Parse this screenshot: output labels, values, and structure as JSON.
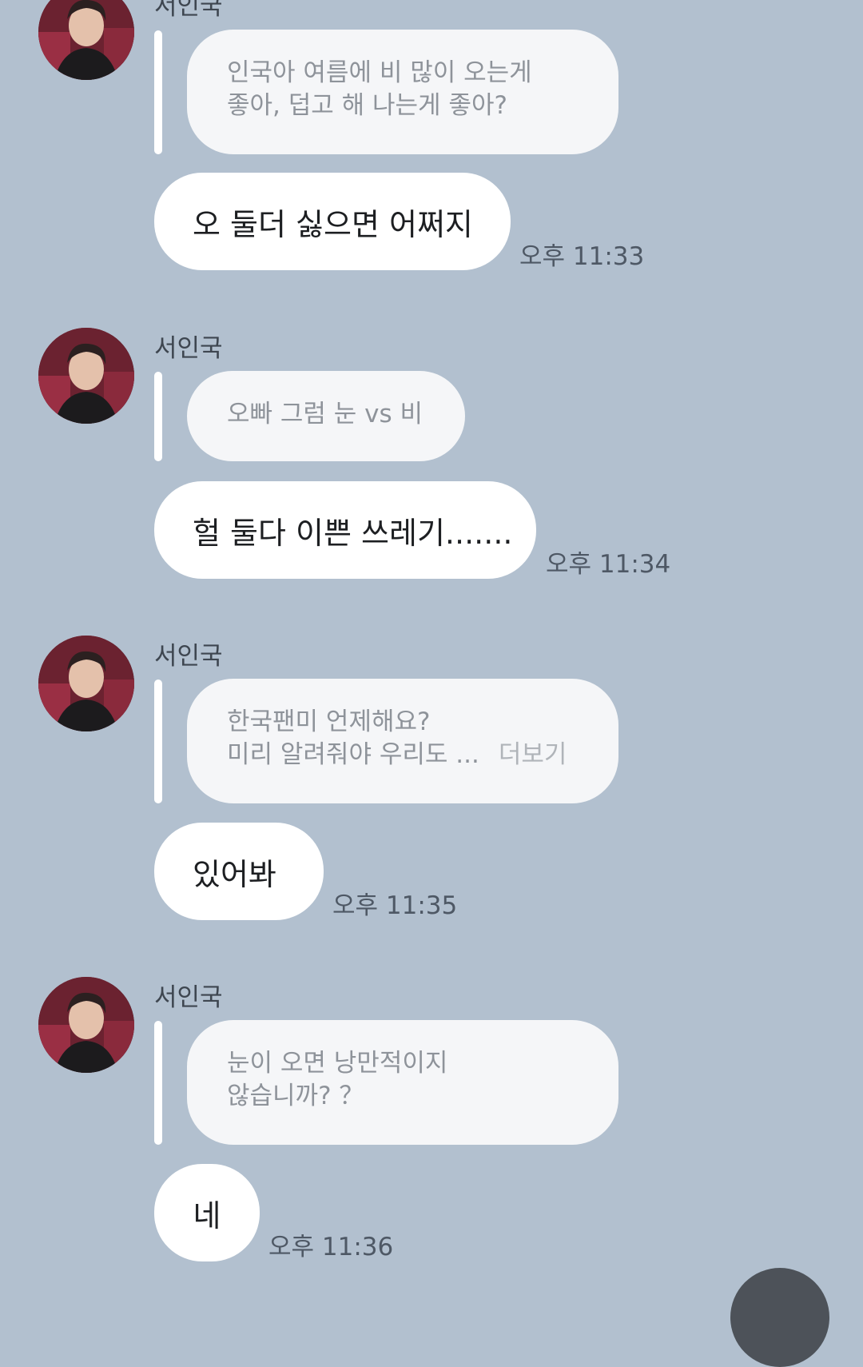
{
  "sender_name": "서인국",
  "messages": [
    {
      "quote_lines": [
        "인국아 여름에 비 많이 오는게",
        "좋아, 덥고 해 나는게 좋아?"
      ],
      "reply": "오 둘더 싫으면 어쩌지",
      "time": "오후 11:33"
    },
    {
      "sender": "서인국",
      "quote_lines": [
        "오빠 그럼 눈 vs 비"
      ],
      "reply": "헐 둘다 이쁜 쓰레기.......",
      "time": "오후 11:34"
    },
    {
      "sender": "서인국",
      "quote_lines": [
        "한국팬미 언제해요?",
        "미리 알려줘야 우리도 ..."
      ],
      "more_label": "더보기",
      "reply": "있어봐",
      "time": "오후 11:35"
    },
    {
      "sender": "서인국",
      "quote_lines": [
        "눈이 오면 낭만적이지",
        "않습니까? ？"
      ],
      "reply": "네",
      "time": "오후 11:36"
    }
  ]
}
